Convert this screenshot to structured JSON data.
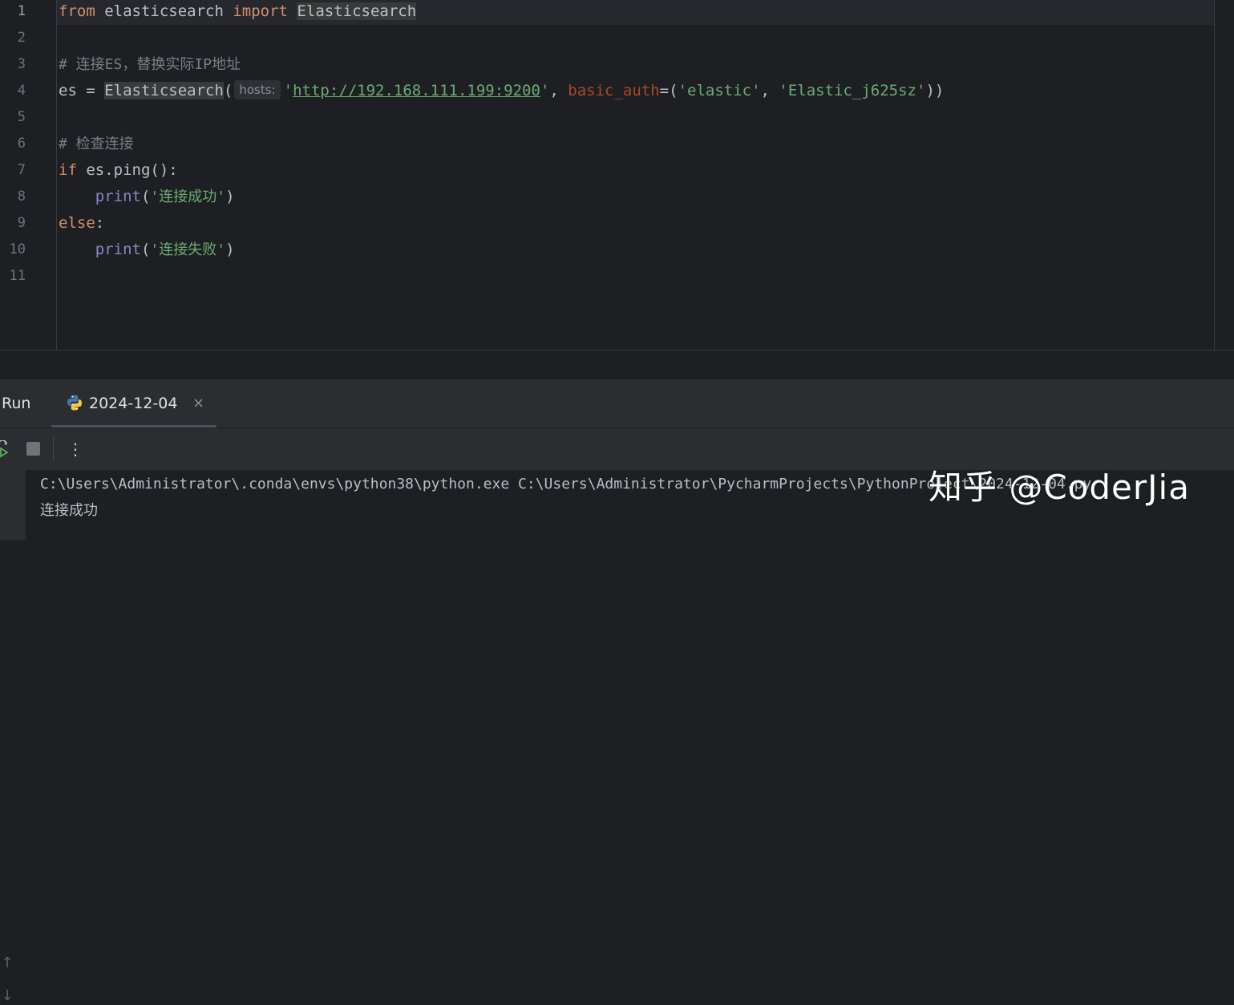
{
  "editor": {
    "line_numbers": [
      "1",
      "2",
      "3",
      "4",
      "5",
      "6",
      "7",
      "8",
      "9",
      "10",
      "11"
    ],
    "lines": {
      "l1": {
        "from": "from",
        "mod": " elasticsearch ",
        "import": "import",
        "sp": " ",
        "cls": "Elasticsearch"
      },
      "l3": {
        "comment": "# 连接ES，替换实际IP地址"
      },
      "l4": {
        "es": "es = ",
        "cls": "Elasticsearch",
        "paren_open": "(",
        "hint": "hosts:",
        "q1": "'",
        "url": "http://192.168.111.199:9200",
        "q2": "'",
        "comma1": ", ",
        "kwarg": "basic_auth",
        "eq": "=(",
        "s1": "'elastic'",
        "comma2": ", ",
        "s2": "'Elastic_j625sz'",
        "close": "))"
      },
      "l6": {
        "comment": "# 检查连接"
      },
      "l7": {
        "if": "if",
        "rest": " es.ping():"
      },
      "l8": {
        "indent": "    ",
        "fn": "print",
        "po": "(",
        "str": "'连接成功'",
        "pc": ")"
      },
      "l9": {
        "else": "else",
        "colon": ":"
      },
      "l10": {
        "indent": "    ",
        "fn": "print",
        "po": "(",
        "str": "'连接失败'",
        "pc": ")"
      }
    }
  },
  "run_panel": {
    "title": "Run",
    "tab_label": "2024-12-04",
    "tab_close": "×",
    "more": "⋮",
    "scroll_up": "↑",
    "scroll_down": "↓",
    "console": {
      "line1": "C:\\Users\\Administrator\\.conda\\envs\\python38\\python.exe C:\\Users\\Administrator\\PycharmProjects\\PythonProject\\2024-12-04.py",
      "line2": "连接成功"
    }
  },
  "watermark": "知乎 @CoderJia",
  "colors": {
    "background": "#1e1f22",
    "keyword": "#cf8e6d",
    "string": "#6aab73",
    "comment": "#7a7e85",
    "builtin": "#8888c6",
    "param_name": "#aa4926"
  }
}
